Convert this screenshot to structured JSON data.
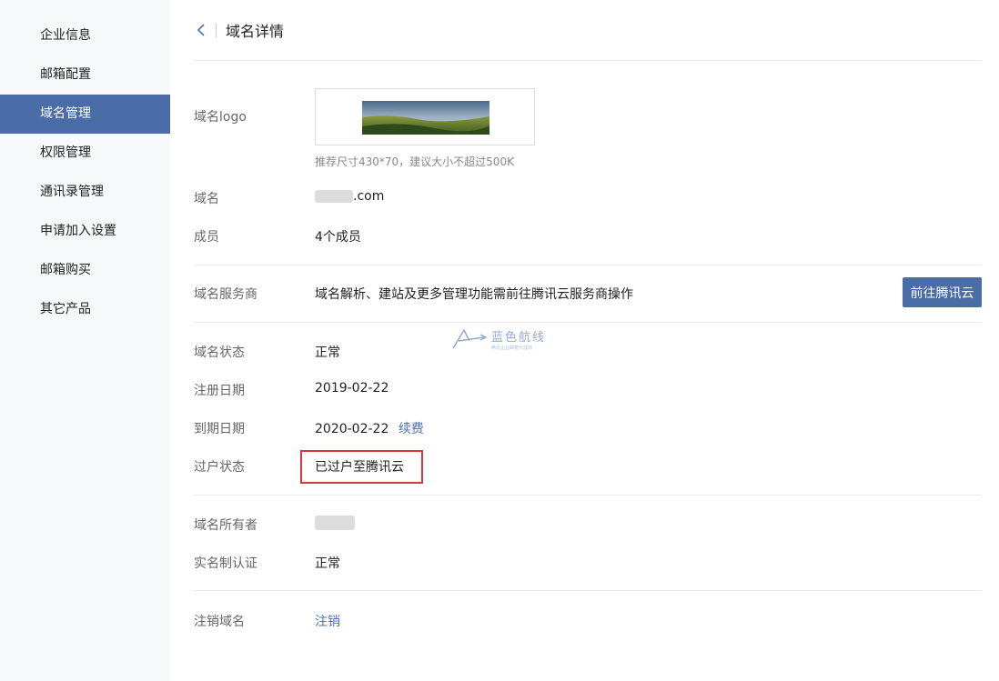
{
  "sidebar": {
    "items": [
      {
        "label": "企业信息"
      },
      {
        "label": "邮箱配置"
      },
      {
        "label": "域名管理"
      },
      {
        "label": "权限管理"
      },
      {
        "label": "通讯录管理"
      },
      {
        "label": "申请加入设置"
      },
      {
        "label": "邮箱购买"
      },
      {
        "label": "其它产品"
      }
    ],
    "active_index": 2
  },
  "header": {
    "title": "域名详情",
    "back_icon": "chevron-left-icon"
  },
  "logo": {
    "label": "域名logo",
    "hint": "推荐尺寸430*70，建议大小不超过500K"
  },
  "domain": {
    "label": "域名",
    "suffix": ".com"
  },
  "members": {
    "label": "成员",
    "value": "4个成员"
  },
  "provider": {
    "label": "域名服务商",
    "value": "域名解析、建站及更多管理功能需前往腾讯云服务商操作",
    "button": "前往腾讯云"
  },
  "status": {
    "label": "域名状态",
    "value": "正常"
  },
  "register_date": {
    "label": "注册日期",
    "value": "2019-02-22"
  },
  "expire_date": {
    "label": "到期日期",
    "value": "2020-02-22",
    "renew": "续费"
  },
  "transfer": {
    "label": "过户状态",
    "value": "已过户至腾讯云"
  },
  "owner": {
    "label": "域名所有者"
  },
  "real_name": {
    "label": "实名制认证",
    "value": "正常"
  },
  "cancel": {
    "label": "注销域名",
    "link": "注销"
  },
  "watermark": {
    "main": "蓝色航线",
    "sub": "腾讯企业邮箱代理商"
  },
  "colors": {
    "accent": "#4a6da7",
    "link": "#4a73b3",
    "highlight": "#d9363e"
  }
}
